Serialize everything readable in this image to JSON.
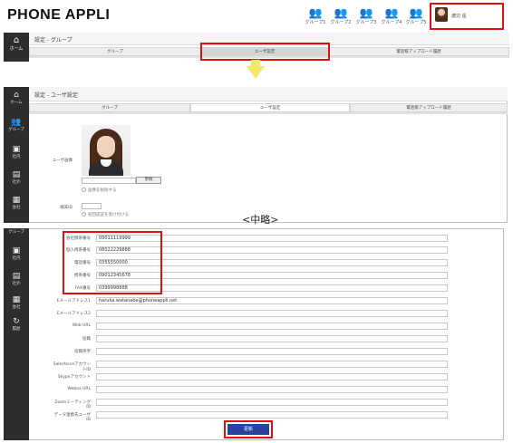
{
  "top": {
    "logo": "PHONE APPLI",
    "groups": [
      "グループ1",
      "グループ2",
      "グループ3",
      "グループ4",
      "グループ5"
    ],
    "user_name": "渡辺 遥",
    "home_label": "ホーム",
    "breadcrumb": "設定 - グループ",
    "tabs": [
      "グループ",
      "ユーザ設定",
      "電話帳アップロード履歴"
    ]
  },
  "settings": {
    "breadcrumb": "設定 - ユーザ設定",
    "tabs": [
      "グループ",
      "ユーザ設定",
      "電話帳アップロード履歴"
    ],
    "sidebar": [
      "ホーム",
      "グループ",
      "社内",
      "社外",
      "会社"
    ],
    "image_label": "ユーザ画像",
    "browse_button": "参照",
    "delete_image_label": "画像を削除する",
    "terminal_label": "端末ID",
    "first_auth_label": "初回認証を受け付ける"
  },
  "omitted_label": "<中略>",
  "form": {
    "sidebar": [
      "グループ",
      "社内",
      "社外",
      "会社",
      "履歴"
    ],
    "fields": [
      {
        "label": "会社携帯番号",
        "value": "09011119999"
      },
      {
        "label": "個人携帯番号",
        "value": "08022229888"
      },
      {
        "label": "電話番号",
        "value": "0355550000"
      },
      {
        "label": "携帯番号",
        "value": "09012345678"
      },
      {
        "label": "FAX番号",
        "value": "0399998888"
      },
      {
        "label": "Eメールアドレス1",
        "value": "haruka.watanabe@phoneappli.net"
      },
      {
        "label": "Eメールアドレス2",
        "value": ""
      },
      {
        "label": "Web URL",
        "value": ""
      },
      {
        "label": "役職",
        "value": ""
      },
      {
        "label": "役職英字",
        "value": ""
      },
      {
        "label": "SalesforceアカウントID",
        "value": ""
      },
      {
        "label": "Skypeアカウント",
        "value": ""
      },
      {
        "label": "Webex URL",
        "value": ""
      },
      {
        "label": "ZoomミーティングID",
        "value": ""
      },
      {
        "label": "データ連携先ユーザID",
        "value": ""
      }
    ],
    "update_button": "更新"
  }
}
